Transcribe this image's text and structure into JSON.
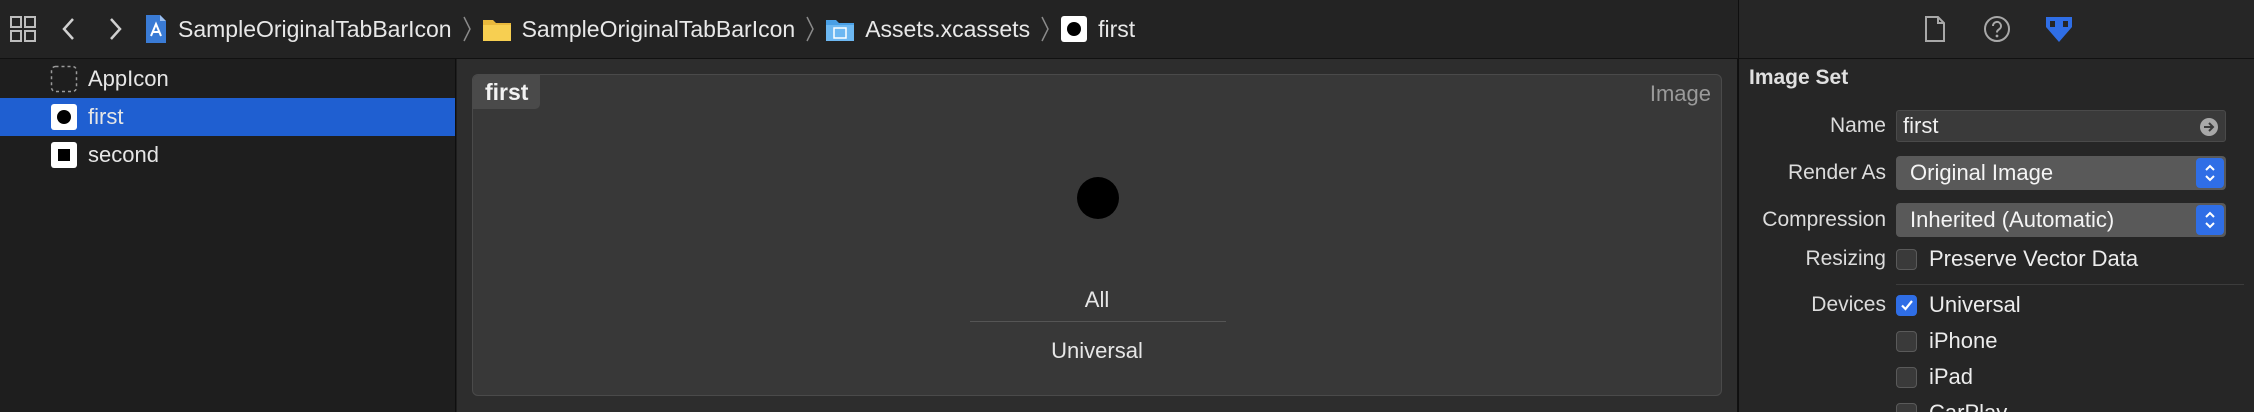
{
  "jumpbar": {
    "crumbs": [
      {
        "label": "SampleOriginalTabBarIcon",
        "icon": "xcode-project-icon"
      },
      {
        "label": "SampleOriginalTabBarIcon",
        "icon": "folder-icon"
      },
      {
        "label": "Assets.xcassets",
        "icon": "asset-catalog-icon"
      },
      {
        "label": "first",
        "icon": "image-set-icon"
      }
    ]
  },
  "asset_list": {
    "items": [
      {
        "label": "AppIcon",
        "selected": false
      },
      {
        "label": "first",
        "selected": true
      },
      {
        "label": "second",
        "selected": false
      }
    ]
  },
  "editor": {
    "title": "first",
    "type": "Image",
    "slot_scale": "All",
    "slot_device": "Universal"
  },
  "inspector": {
    "section_title": "Image Set",
    "name_label": "Name",
    "name_value": "first",
    "render_as_label": "Render As",
    "render_as_value": "Original Image",
    "compression_label": "Compression",
    "compression_value": "Inherited (Automatic)",
    "resizing_label": "Resizing",
    "preserve_vector": "Preserve Vector Data",
    "devices_label": "Devices",
    "devices": [
      {
        "label": "Universal",
        "checked": true
      },
      {
        "label": "iPhone",
        "checked": false
      },
      {
        "label": "iPad",
        "checked": false
      },
      {
        "label": "CarPlay",
        "checked": false
      }
    ]
  },
  "colors": {
    "selection": "#1f5fd1",
    "accent": "#2f6ee6"
  }
}
